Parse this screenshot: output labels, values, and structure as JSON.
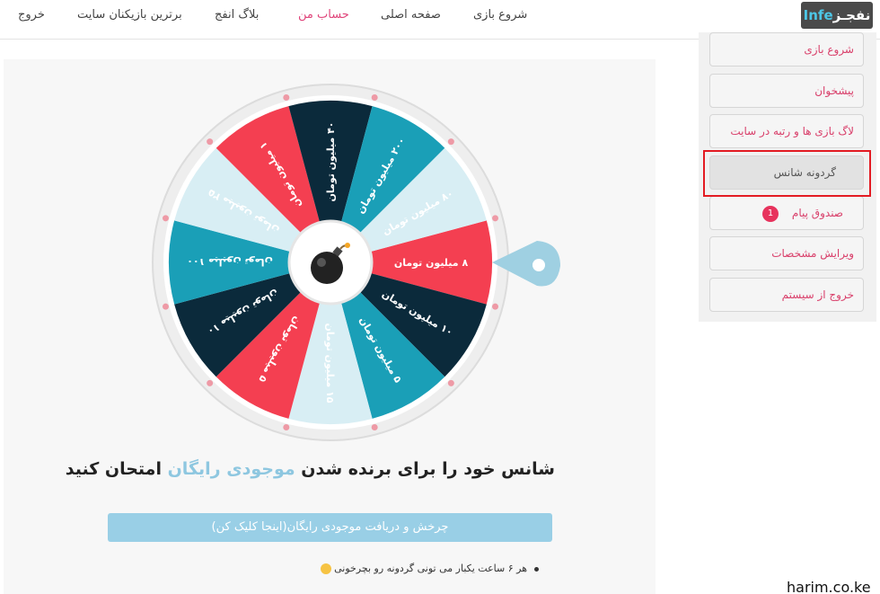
{
  "header": {
    "logo_text": "نفجـز",
    "logo_accent": "Infe",
    "nav": [
      {
        "label": "شروع بازی",
        "active": false
      },
      {
        "label": "صفحه اصلی",
        "active": false
      },
      {
        "label": "حساب من",
        "active": true
      },
      {
        "label": "بلاگ انفج",
        "active": false
      },
      {
        "label": "برترین بازیکنان سایت",
        "active": false
      },
      {
        "label": "خروج",
        "active": false
      }
    ]
  },
  "sidebar": {
    "items": [
      {
        "label": "شروع بازی"
      },
      {
        "label": "پیشخوان"
      },
      {
        "label": "لاگ بازی ها و رتبه در سایت"
      },
      {
        "label": "گردونه شانس",
        "current": true
      },
      {
        "label": "صندوق پیام",
        "badge": "1"
      },
      {
        "label": "ویرایش مشخصات"
      },
      {
        "label": "خروج از سیستم"
      }
    ]
  },
  "wheel": {
    "segments": [
      {
        "label": "۸ میلیون تومان",
        "color": "#f43f51"
      },
      {
        "label": "۱۰ میلیون تومان",
        "color": "#0b2a3b"
      },
      {
        "label": "۵ میلیون تومان",
        "color": "#1a9fb7"
      },
      {
        "label": "۱۵ میلیون تومان",
        "color": "#d8eef4"
      },
      {
        "label": "۵ میلیون تومان",
        "color": "#f43f51"
      },
      {
        "label": "۱۰ میلیون تومان",
        "color": "#0b2a3b"
      },
      {
        "label": "۱۰۰ میلیون تومان",
        "color": "#1a9fb7"
      },
      {
        "label": "۲۵ میلیون تومان",
        "color": "#d8eef4"
      },
      {
        "label": "۱ میلیون تومان",
        "color": "#f43f51"
      },
      {
        "label": "۴۰ میلیون تومان",
        "color": "#0b2a3b"
      },
      {
        "label": "۲۰۰ میلیون تومان",
        "color": "#1a9fb7"
      },
      {
        "label": "۸۰ میلیون تومان",
        "color": "#d8eef4"
      }
    ],
    "dark_text_color": "#0b2a3b"
  },
  "headline": {
    "before": "شانس خود را برای برنده شدن",
    "highlight": "موجودی رایگان",
    "after": "امتحان کنید"
  },
  "spin_button": {
    "label": "چرخش و دریافت موجودی رایگان(اینجا کلیک کن)"
  },
  "note": {
    "text": "هر ۶ ساعت یکبار می تونی گردونه رو بچرخونی"
  },
  "watermark": "harim.co.ke"
}
